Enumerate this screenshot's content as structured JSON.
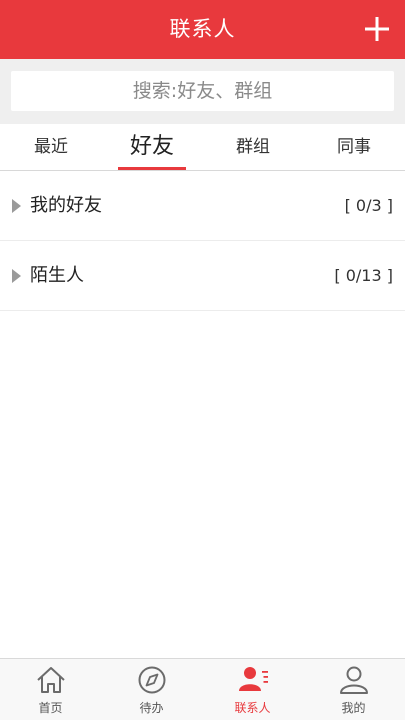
{
  "header": {
    "title": "联系人",
    "add_icon": "plus-icon"
  },
  "search": {
    "placeholder": "搜索:好友、群组",
    "value": ""
  },
  "tabs": [
    {
      "label": "最近",
      "active": false
    },
    {
      "label": "好友",
      "active": true
    },
    {
      "label": "群组",
      "active": false
    },
    {
      "label": "同事",
      "active": false
    }
  ],
  "groups": [
    {
      "name": "我的好友",
      "count": "[ 0/3 ]",
      "icon": "caret-right-icon"
    },
    {
      "name": "陌生人",
      "count": "[ 0/13 ]",
      "icon": "caret-right-icon"
    }
  ],
  "bottom_nav": [
    {
      "label": "首页",
      "icon": "home-icon",
      "active": false
    },
    {
      "label": "待办",
      "icon": "compass-icon",
      "active": false
    },
    {
      "label": "联系人",
      "icon": "contacts-icon",
      "active": true
    },
    {
      "label": "我的",
      "icon": "person-icon",
      "active": false
    }
  ],
  "colors": {
    "accent": "#e8393d",
    "search_bg": "#efefef",
    "nav_bg": "#f8f8f8"
  }
}
